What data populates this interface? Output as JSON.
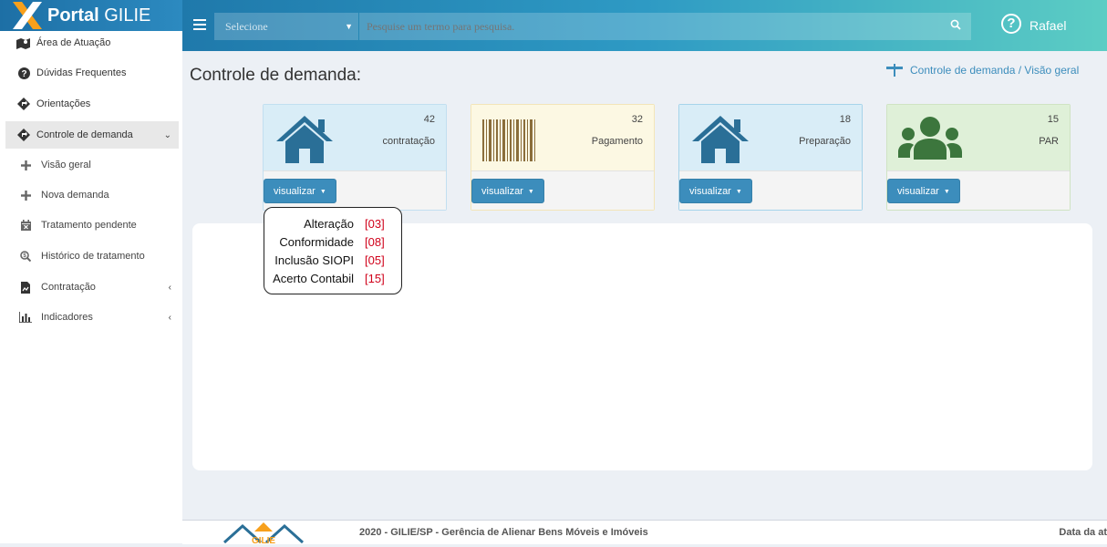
{
  "app": {
    "name_bold": "Portal",
    "name_light": "GILIE"
  },
  "topbar": {
    "select_value": "Selecione",
    "search_placeholder": "Pesquise um termo para pesquisa.",
    "help_glyph": "?",
    "user_name": "Rafael"
  },
  "sidebar": {
    "items": [
      {
        "label": "Área de Atuação",
        "icon": "map-icon"
      },
      {
        "label": "Dúvidas Frequentes",
        "icon": "question-circle-icon"
      },
      {
        "label": "Orientações",
        "icon": "diamond-arrow-icon"
      },
      {
        "label": "Controle de demanda",
        "icon": "diamond-arrow-icon",
        "expanded": true
      },
      {
        "label": "Visão geral",
        "icon": "plus-icon"
      },
      {
        "label": "Nova demanda",
        "icon": "plus-icon"
      },
      {
        "label": "Tratamento pendente",
        "icon": "calendar-x-icon"
      },
      {
        "label": "Histórico de tratamento",
        "icon": "search-dollar-icon"
      },
      {
        "label": "Contratação",
        "icon": "file-chart-icon"
      },
      {
        "label": "Indicadores",
        "icon": "bar-chart-icon"
      }
    ]
  },
  "page": {
    "title": "Controle de demanda:",
    "breadcrumb": "Controle de demanda / Visão geral"
  },
  "cards": [
    {
      "count": "42",
      "label": "contratação",
      "icon": "home-icon",
      "button": "visualizar",
      "color": "#2a6f97"
    },
    {
      "count": "32",
      "label": "Pagamento",
      "icon": "barcode-icon",
      "button": "visualizar",
      "color": "#8a6d3b"
    },
    {
      "count": "18",
      "label": "Preparação",
      "icon": "home-icon",
      "button": "visualizar",
      "color": "#2a6f97"
    },
    {
      "count": "15",
      "label": "PAR",
      "icon": "users-icon",
      "button": "visualizar",
      "color": "#3c763d"
    }
  ],
  "dropdown": {
    "items": [
      {
        "label": "Alteração",
        "value": "[03]"
      },
      {
        "label": "Conformidade",
        "value": "[08]"
      },
      {
        "label": "Inclusão SIOPI",
        "value": "[05]"
      },
      {
        "label": "Acerto Contabil",
        "value": "[15]"
      }
    ]
  },
  "footer": {
    "text": "2020 - GILIE/SP - Gerência de Alienar Bens Móveis e Imóveis",
    "right": "Data da at",
    "logo_text": "GILIE"
  }
}
